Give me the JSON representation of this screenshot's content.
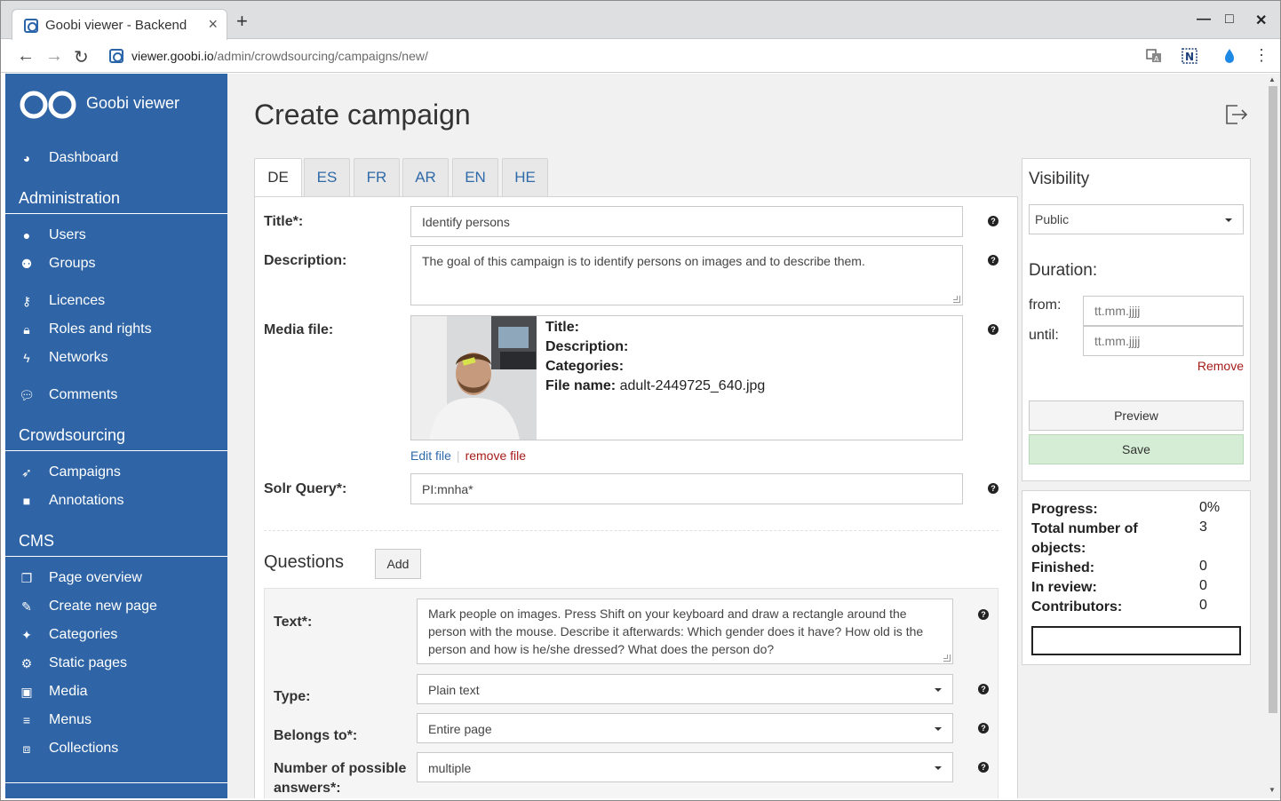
{
  "browser": {
    "tab_title": "Goobi viewer - Backend",
    "tab_close": "×",
    "new_tab": "+",
    "url_host": "viewer.goobi.io",
    "url_path": "/admin/crowdsourcing/campaigns/new/",
    "window_controls": {
      "minimize": "—",
      "maximize": "□",
      "close": "✕"
    },
    "nav": {
      "back": "←",
      "forward": "→",
      "reload": "↻"
    }
  },
  "sidebar": {
    "brand": "Goobi viewer",
    "dashboard": {
      "label": "Dashboard",
      "icon": "dashboard-icon"
    },
    "sections": [
      {
        "title": "Administration"
      },
      {
        "title": "Crowdsourcing"
      },
      {
        "title": "CMS"
      }
    ],
    "admin_items": [
      {
        "label": "Users",
        "icon": "user-icon"
      },
      {
        "label": "Groups",
        "icon": "users-icon"
      },
      {
        "label": "Licences",
        "icon": "key-icon"
      },
      {
        "label": "Roles and rights",
        "icon": "lock-icon"
      },
      {
        "label": "Networks",
        "icon": "bolt-icon"
      },
      {
        "label": "Comments",
        "icon": "comments-icon"
      }
    ],
    "crowd_items": [
      {
        "label": "Campaigns",
        "icon": "rocket-icon"
      },
      {
        "label": "Annotations",
        "icon": "note-icon"
      }
    ],
    "cms_items": [
      {
        "label": "Page overview",
        "icon": "copy-icon"
      },
      {
        "label": "Create new page",
        "icon": "edit-icon"
      },
      {
        "label": "Categories",
        "icon": "thumbtack-icon"
      },
      {
        "label": "Static pages",
        "icon": "cogs-icon"
      },
      {
        "label": "Media",
        "icon": "image-icon"
      },
      {
        "label": "Menus",
        "icon": "menu-icon"
      },
      {
        "label": "Collections",
        "icon": "collection-icon"
      }
    ]
  },
  "main": {
    "title": "Create campaign",
    "language_tabs": [
      "DE",
      "ES",
      "FR",
      "AR",
      "EN",
      "HE"
    ],
    "active_tab": "DE",
    "form": {
      "title_label": "Title*:",
      "title_value": "Identify persons",
      "description_label": "Description:",
      "description_value": "The goal of this campaign is to identify persons on images and to describe them.",
      "media_label": "Media file:",
      "media": {
        "title_key": "Title:",
        "description_key": "Description:",
        "categories_key": "Categories:",
        "filename_key": "File name:",
        "filename_value": "adult-2449725_640.jpg",
        "edit_link": "Edit file",
        "remove_link": "remove file",
        "separator": "|"
      },
      "solr_label": "Solr Query*:",
      "solr_value": "PI:mnha*",
      "help_glyph": "?"
    },
    "questions": {
      "heading": "Questions",
      "add_button": "Add",
      "text_label": "Text*:",
      "text_value": "Mark people on images. Press Shift on your keyboard and draw a rectangle around the person with the mouse. Describe it afterwards: Which gender does it have? How old is the person and how is he/she dressed? What does the person do?",
      "type_label": "Type:",
      "type_value": "Plain text",
      "belongs_label": "Belongs to*:",
      "belongs_value": "Entire page",
      "answers_label": "Number of possible answers*:",
      "answers_value": "multiple"
    }
  },
  "visibility_panel": {
    "heading": "Visibility",
    "visibility_value": "Public",
    "duration_heading": "Duration:",
    "from_label": "from:",
    "from_placeholder": "tt.mm.jjjj",
    "until_label": "until:",
    "until_placeholder": "tt.mm.jjjj",
    "remove_link": "Remove",
    "preview_button": "Preview",
    "save_button": "Save"
  },
  "stats_panel": {
    "progress_label": "Progress:",
    "progress_value": "0%",
    "progress_fraction": 0,
    "total_label": "Total number of objects:",
    "total_value": "3",
    "finished_label": "Finished:",
    "finished_value": "0",
    "review_label": "In review:",
    "review_value": "0",
    "contributors_label": "Contributors:",
    "contributors_value": "0"
  },
  "colors": {
    "sidebar": "#2f65a6",
    "link": "#2f6aa8",
    "danger": "#a61b1b",
    "save": "#d4edd4"
  }
}
